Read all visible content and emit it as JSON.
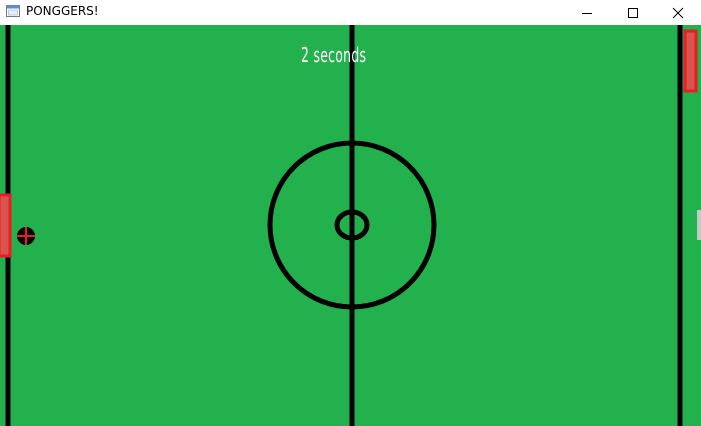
{
  "window": {
    "title": "PONGGERS!",
    "app_icon": "window-app-icon",
    "controls": {
      "minimize_icon": "minimize-icon",
      "maximize_icon": "maximize-icon",
      "close_icon": "close-icon"
    }
  },
  "game": {
    "countdown_text": "2 seconds",
    "colors": {
      "field": "#23b14d",
      "lines": "#000000",
      "paddle_fill": "#d9534f",
      "paddle_border": "#ed1c24",
      "ball": "#000000",
      "ball_cross": "#ed1c24",
      "countdown_text": "#ffffff"
    }
  }
}
